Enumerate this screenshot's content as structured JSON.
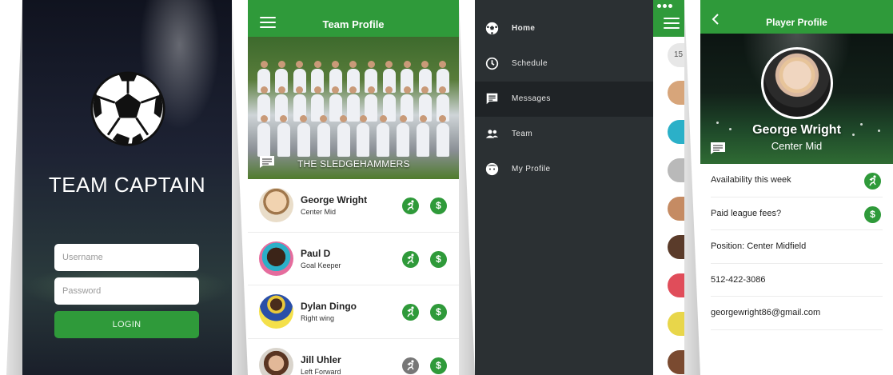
{
  "login": {
    "app_title": "TEAM CAPTAIN",
    "username_placeholder": "Username",
    "password_placeholder": "Password",
    "login_label": "LOGIN"
  },
  "team": {
    "header_title": "Team Profile",
    "team_name": "THE SLEDGEHAMMERS",
    "players": [
      {
        "name": "George Wright",
        "position": "Center Mid",
        "availability_active": true,
        "fees_paid": true
      },
      {
        "name": "Paul D",
        "position": "Goal Keeper",
        "availability_active": true,
        "fees_paid": true
      },
      {
        "name": "Dylan Dingo",
        "position": "Right wing",
        "availability_active": true,
        "fees_paid": true
      },
      {
        "name": "Jill Uhler",
        "position": "Left Forward",
        "availability_active": false,
        "fees_paid": true
      }
    ]
  },
  "menu": {
    "items": [
      {
        "label": "Home",
        "icon": "soccer-ball-icon",
        "active": false
      },
      {
        "label": "Schedule",
        "icon": "clock-icon",
        "active": false
      },
      {
        "label": "Messages",
        "icon": "message-icon",
        "active": true
      },
      {
        "label": "Team",
        "icon": "people-icon",
        "active": false
      },
      {
        "label": "My Profile",
        "icon": "profile-face-icon",
        "active": false
      }
    ],
    "peek_badge": "15"
  },
  "player": {
    "header_title": "Player Profile",
    "name": "George Wright",
    "position": "Center Mid",
    "rows": [
      {
        "text": "Availability this week",
        "icon": "running-icon"
      },
      {
        "text": "Paid league fees?",
        "icon": "dollar-icon"
      },
      {
        "text": "Position: Center Midfield"
      },
      {
        "text": "512-422-3086"
      },
      {
        "text": "georgewright86@gmail.com"
      }
    ]
  },
  "colors": {
    "brand_green": "#2f9a3a",
    "menu_bg": "#2b3033",
    "menu_active": "#1f2326"
  }
}
